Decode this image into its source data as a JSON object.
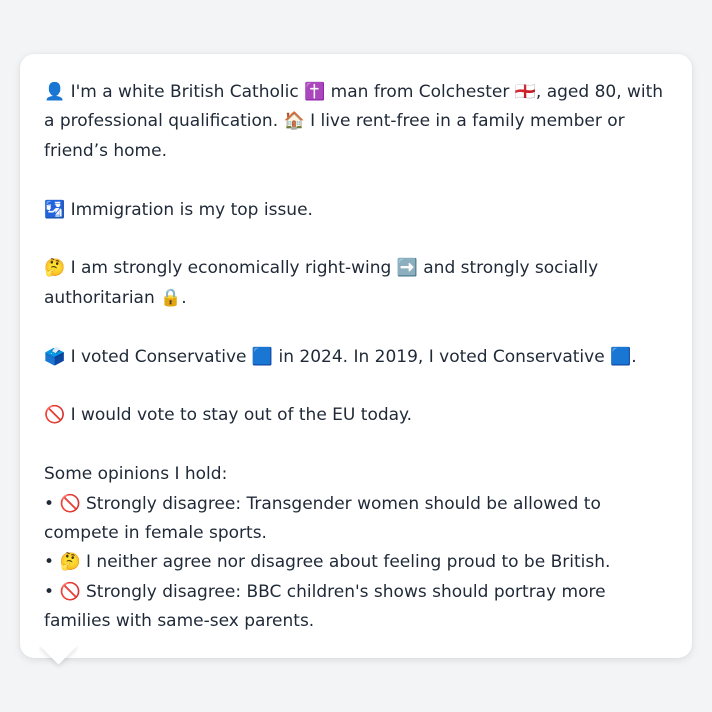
{
  "message": {
    "identity_line": "👤 I'm a white British Catholic ✝️ man from Colchester 🏴󠁧󠁢󠁥󠁮󠁧󠁿, aged 80, with a professional qualification. 🏠 I live rent-free in a family member or friend’s home.",
    "top_issue_line": "🛂 Immigration is my top issue.",
    "ideology_line": "🤔 I am strongly economically right-wing ➡️ and strongly socially authoritarian 🔒.",
    "votes_line": "🗳️ I voted Conservative 🟦 in 2024. In 2019, I voted Conservative 🟦.",
    "eu_line": "🚫 I would vote to stay out of the EU today.",
    "opinions_heading": "Some opinions I hold:",
    "bullet_char": "•",
    "opinions": [
      "🚫 Strongly disagree: Transgender women should be allowed to compete in female sports.",
      "🤔 I neither agree nor disagree about feeling proud to be British.",
      "🚫 Strongly disagree: BBC children's shows should portray more families with same-sex parents."
    ]
  },
  "colors": {
    "page_background": "#f3f4f6",
    "bubble_background": "#ffffff",
    "text": "#1f2937"
  }
}
